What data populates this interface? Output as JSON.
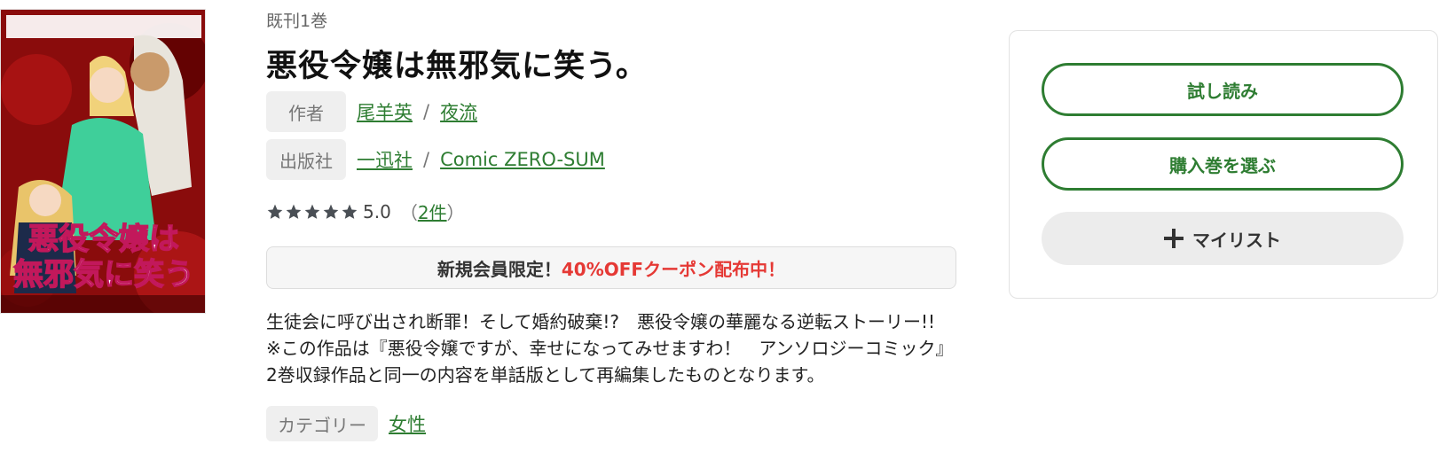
{
  "book": {
    "cover_alt": "悪役令嬢は無邪気に笑う。",
    "volume_info": "既刊1巻",
    "title": "悪役令嬢は無邪気に笑う。",
    "author_label": "作者",
    "authors": [
      "尾羊英",
      "夜流"
    ],
    "publisher_label": "出版社",
    "publishers": [
      "一迅社",
      "Comic ZERO-SUM"
    ],
    "separator": "/",
    "rating": {
      "stars": 5,
      "score": "5.0",
      "open_paren": "（",
      "count": "2件",
      "close_paren": "）"
    },
    "coupon": {
      "prefix": "新規会員限定！",
      "highlight": "40%OFFクーポン配布中！"
    },
    "description": "生徒会に呼び出され断罪！そして婚約破棄!?　悪役令嬢の華麗なる逆転ストーリー!!　※この作品は『悪役令嬢ですが、幸せになってみせますわ！　アンソロジーコミック』2巻収録作品と同一の内容を単話版として再編集したものとなります。",
    "category_label": "カテゴリー",
    "category": "女性"
  },
  "actions": {
    "trial_read": "試し読み",
    "choose_volume": "購入巻を選ぶ",
    "my_list": "マイリスト"
  },
  "colors": {
    "accent_green": "#2e7d32",
    "coupon_red": "#e53935",
    "star_color": "#4a4f55"
  }
}
